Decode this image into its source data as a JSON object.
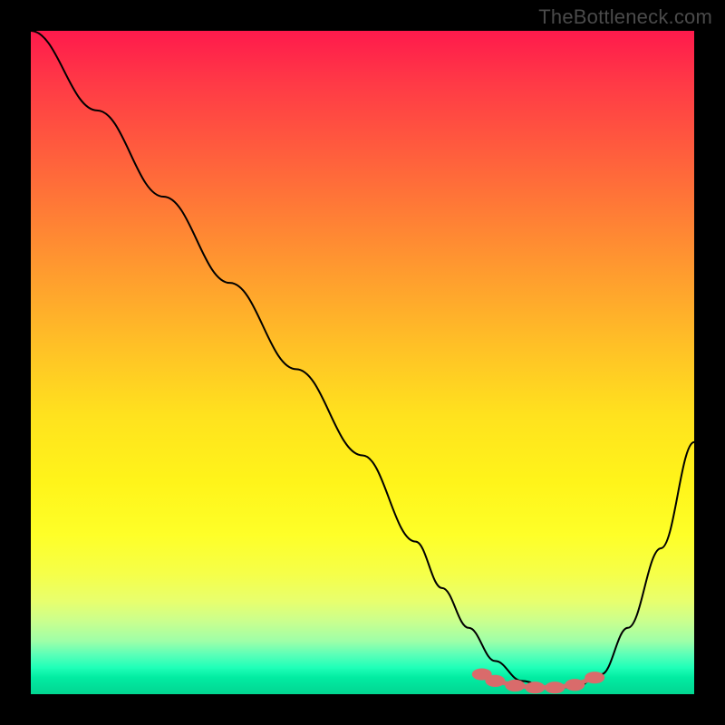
{
  "watermark": "TheBottleneck.com",
  "chart_data": {
    "type": "line",
    "title": "",
    "xlabel": "",
    "ylabel": "",
    "xlim": [
      0,
      100
    ],
    "ylim": [
      0,
      100
    ],
    "grid": false,
    "series": [
      {
        "name": "bottleneck-curve",
        "x": [
          0,
          10,
          20,
          30,
          40,
          50,
          58,
          62,
          66,
          70,
          74,
          78,
          82,
          86,
          90,
          95,
          100
        ],
        "y": [
          100,
          88,
          75,
          62,
          49,
          36,
          23,
          16,
          10,
          5,
          2,
          1,
          1,
          3,
          10,
          22,
          38
        ],
        "color": "#000000"
      },
      {
        "name": "optimal-markers",
        "type": "scatter",
        "x": [
          68,
          70,
          73,
          76,
          79,
          82,
          85
        ],
        "y": [
          3.0,
          2.0,
          1.3,
          1.0,
          1.0,
          1.4,
          2.5
        ],
        "color": "#d96b6b"
      }
    ],
    "background_gradient": {
      "direction": "vertical",
      "stops": [
        {
          "pos": 0.0,
          "color": "#ff1a4c"
        },
        {
          "pos": 0.5,
          "color": "#ffd020"
        },
        {
          "pos": 0.8,
          "color": "#f8ff40"
        },
        {
          "pos": 1.0,
          "color": "#02d892"
        }
      ]
    }
  }
}
